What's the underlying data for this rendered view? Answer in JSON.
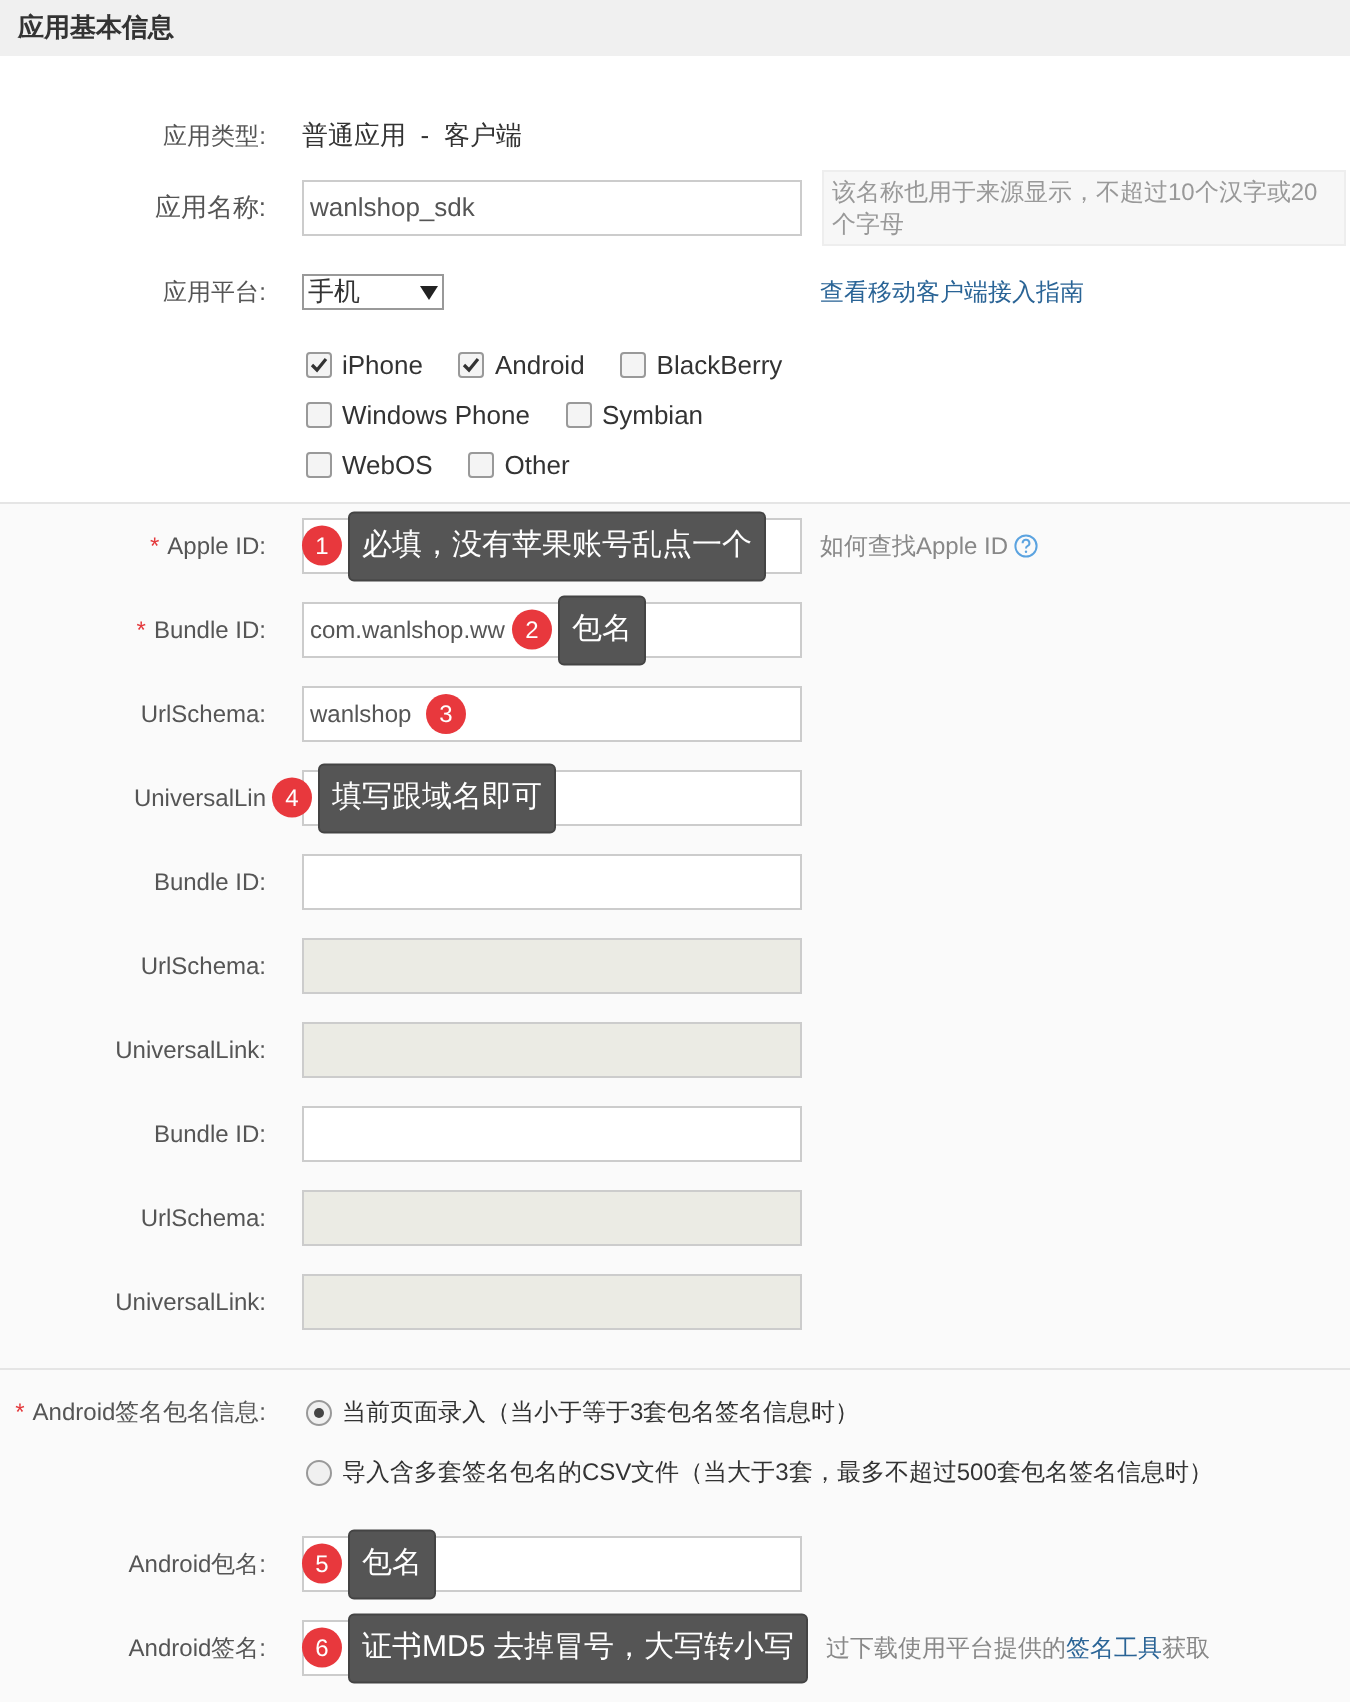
{
  "header": {
    "title": "应用基本信息"
  },
  "basic": {
    "type_label": "应用类型:",
    "type_value": "普通应用  -  客户端",
    "name_label": "应用名称:",
    "name_value": "wanlshop_sdk",
    "name_hint": "该名称也用于来源显示，不超过10个汉字或20个字母",
    "platform_label": "应用平台:",
    "platform_value": "手机",
    "guide_link": "查看移动客户端接入指南",
    "platforms": [
      [
        {
          "label": "iPhone",
          "checked": true
        },
        {
          "label": "Android",
          "checked": true
        },
        {
          "label": "BlackBerry",
          "checked": false
        }
      ],
      [
        {
          "label": "Windows Phone",
          "checked": false
        },
        {
          "label": "Symbian",
          "checked": false
        }
      ],
      [
        {
          "label": "WebOS",
          "checked": false
        },
        {
          "label": "Other",
          "checked": false
        }
      ]
    ]
  },
  "ios_fields": [
    {
      "label": "Apple ID:",
      "required_mark": "*",
      "disabled": false,
      "help": "如何查找Apple ID",
      "annotation": {
        "number": "1",
        "text": "必填，没有苹果账号乱点一个"
      }
    },
    {
      "label": "Bundle ID:",
      "required_mark": "*",
      "value": "com.wanlshop.ww",
      "disabled": false,
      "annotation": {
        "number": "2",
        "text": "包名"
      }
    },
    {
      "label": "UrlSchema:",
      "value": "wanlshop",
      "disabled": false,
      "annotation": {
        "number": "3"
      }
    },
    {
      "label": "UniversalLin",
      "disabled": false,
      "annotation": {
        "number": "4",
        "text": "填写跟域名即可"
      }
    },
    {
      "label": "Bundle ID:",
      "disabled": false
    },
    {
      "label": "UrlSchema:",
      "disabled": true
    },
    {
      "label": "UniversalLink:",
      "disabled": true
    },
    {
      "label": "Bundle ID:",
      "disabled": false
    },
    {
      "label": "UrlSchema:",
      "disabled": true
    },
    {
      "label": "UniversalLink:",
      "disabled": true
    }
  ],
  "android": {
    "label": "Android签名包名信息:",
    "required_mark": "*",
    "options": [
      {
        "text": "当前页面录入（当小于等于3套包名签名信息时）",
        "selected": true
      },
      {
        "text": "导入含多套签名包名的CSV文件（当大于3套，最多不超过500套包名签名信息时）",
        "selected": false
      }
    ],
    "fields": [
      {
        "label": "Android包名:",
        "annotation": {
          "number": "5",
          "text": "包名"
        }
      },
      {
        "label": "Android签名:",
        "help_before": "过下载使用平台提供的",
        "help_link": "签名工具",
        "help_after": "获取",
        "annotation": {
          "number": "6",
          "text": "证书MD5 去掉冒号，大写转小写"
        }
      }
    ]
  }
}
